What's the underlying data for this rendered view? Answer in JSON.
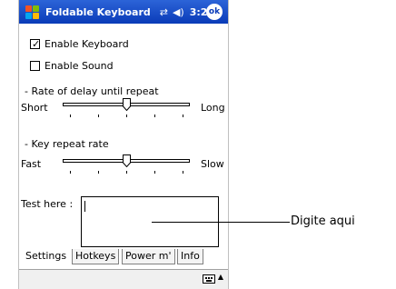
{
  "titlebar": {
    "app_title": "Foldable Keyboard",
    "clock": "3:21",
    "ok_label": "ok",
    "connectivity_icon": "connectivity-icon",
    "volume_icon": "speaker-icon"
  },
  "settings": {
    "enable_keyboard": {
      "label": "Enable Keyboard",
      "checked": true
    },
    "enable_sound": {
      "label": "Enable Sound",
      "checked": false
    },
    "delay": {
      "heading": "- Rate of delay until repeat",
      "min_label": "Short",
      "max_label": "Long",
      "value": 0.5
    },
    "repeat": {
      "heading": "- Key repeat rate",
      "min_label": "Fast",
      "max_label": "Slow",
      "value": 0.5
    },
    "test_label": "Test here :",
    "test_value": ""
  },
  "tabs": [
    {
      "label": "Settings",
      "active": true
    },
    {
      "label": "Hotkeys",
      "active": false
    },
    {
      "label": "Power m'",
      "active": false
    },
    {
      "label": "Info",
      "active": false
    }
  ],
  "callout": {
    "text": "Digite aqui"
  },
  "colors": {
    "titlebar": "#0a3bb8",
    "menubar": "#f0f0f0"
  }
}
